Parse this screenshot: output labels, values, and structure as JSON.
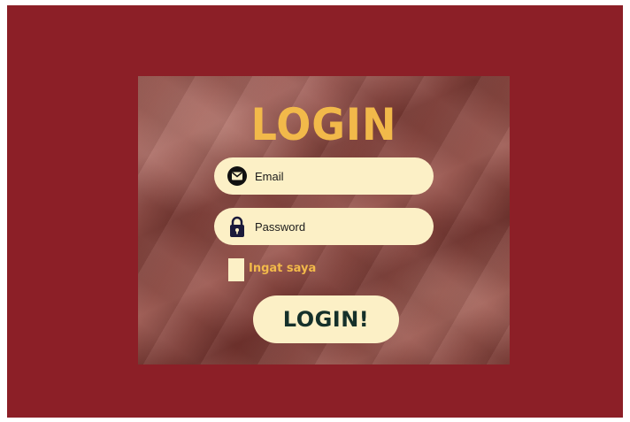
{
  "login_card": {
    "title": "LOGIN",
    "email": {
      "placeholder": "Email",
      "value": "",
      "icon": "envelope-icon"
    },
    "password": {
      "placeholder": "Password",
      "value": "",
      "icon": "padlock-icon"
    },
    "remember_label": "Ingat saya",
    "remember_checked": false,
    "submit_label": "LOGIN!"
  },
  "colors": {
    "background": "#8c1f27",
    "accent": "#f2b94a",
    "field": "#fcf0c6",
    "button_text": "#15302a",
    "icon": "#1a1a3a"
  }
}
